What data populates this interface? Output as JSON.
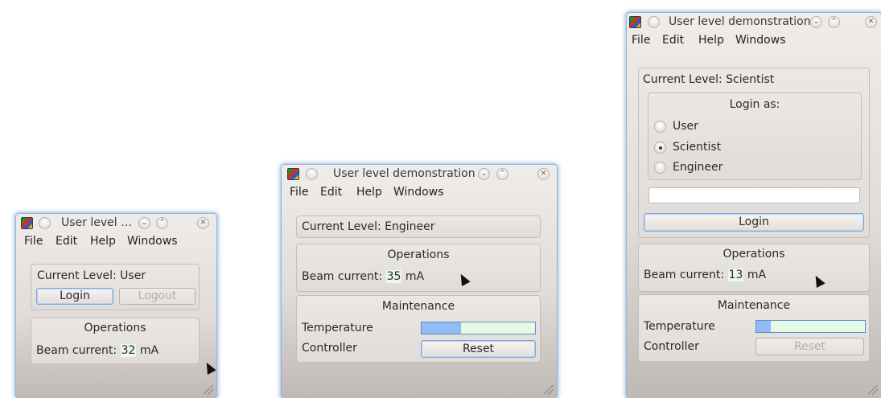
{
  "windows": [
    {
      "title": "User level …",
      "menu": [
        "File",
        "Edit",
        "Help",
        "Windows"
      ],
      "current_level": "Current Level: User",
      "login_button": "Login",
      "logout_button": "Logout",
      "operations": {
        "heading": "Operations",
        "beam_label": "Beam current:",
        "beam_value": "32",
        "beam_unit": "mA"
      }
    },
    {
      "title": "User level demonstration",
      "menu": [
        "File",
        "Edit",
        "Help",
        "Windows"
      ],
      "current_level": "Current Level: Engineer",
      "operations": {
        "heading": "Operations",
        "beam_label": "Beam current:",
        "beam_value": "35",
        "beam_unit": "mA"
      },
      "maintenance": {
        "heading": "Maintenance",
        "temperature_label": "Temperature",
        "temperature_level": 0.35,
        "controller_label": "Controller",
        "reset_button": "Reset"
      }
    },
    {
      "title": "User level demonstration",
      "menu": [
        "File",
        "Edit",
        "Help",
        "Windows"
      ],
      "current_level": "Current Level: Scientist",
      "login_as": {
        "heading": "Login as:",
        "options": [
          "User",
          "Scientist",
          "Engineer"
        ],
        "selected": "Scientist",
        "password_value": ""
      },
      "login_button": "Login",
      "operations": {
        "heading": "Operations",
        "beam_label": "Beam current:",
        "beam_value": "13",
        "beam_unit": "mA"
      },
      "maintenance": {
        "heading": "Maintenance",
        "temperature_label": "Temperature",
        "temperature_level": 0.13,
        "controller_label": "Controller",
        "reset_button": "Reset"
      }
    }
  ],
  "colors": {
    "glow": "#78a5d7",
    "value_bg": "#ecf8ec",
    "bar_fill": "#8fbcf2",
    "bar_bg": "#e4fae4"
  },
  "icons": [
    "app-icon",
    "minimize-icon",
    "maximize-icon",
    "close-icon",
    "resize-grip-icon",
    "mouse-cursor-icon"
  ]
}
